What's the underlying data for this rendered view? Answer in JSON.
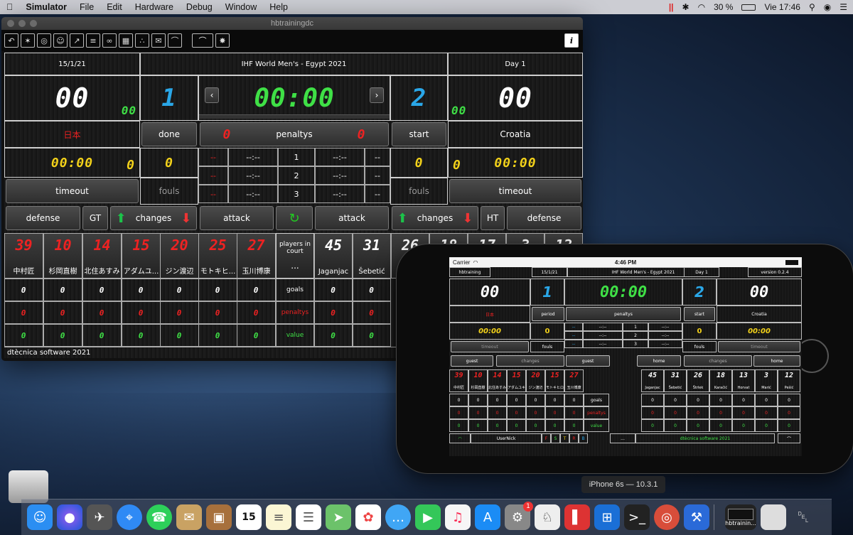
{
  "menubar": {
    "apple": "",
    "app": "Simulator",
    "items": [
      "File",
      "Edit",
      "Hardware",
      "Debug",
      "Window",
      "Help"
    ],
    "battery": "30 %",
    "clock": "Vie 17:46"
  },
  "window": {
    "title": "hbtrainingdc"
  },
  "board": {
    "date": "15/1/21",
    "event": "IHF World Men's - Egypt 2021",
    "day": "Day 1",
    "home_score": "00",
    "home_fouls_small": "00",
    "home_number": "1",
    "clock": "00:00",
    "away_number": "2",
    "away_score": "00",
    "away_fouls_small": "00",
    "home_name": "日本",
    "done_label": "done",
    "penalty_home": "0",
    "penaltys_label": "penaltys",
    "penalty_away": "0",
    "start_label": "start",
    "away_name": "Croatia",
    "home_timer": "00:00",
    "home_timer_count": "0",
    "home_fouls": "0",
    "away_fouls": "0",
    "away_timer_count": "0",
    "away_timer": "00:00",
    "timeout_label": "timeout",
    "fouls_label": "fouls",
    "periods": [
      {
        "ld": "--",
        "lt": "--:--",
        "n": "1",
        "rt": "--:--",
        "rd": "--"
      },
      {
        "ld": "--",
        "lt": "--:--",
        "n": "2",
        "rt": "--:--",
        "rd": "--"
      },
      {
        "ld": "--",
        "lt": "--:--",
        "n": "3",
        "rt": "--:--",
        "rd": "--"
      }
    ],
    "defense_label": "defense",
    "gt_label": "GT",
    "changes_label": "changes",
    "attack_label": "attack",
    "ht_label": "HT",
    "players_in_court": "players in court",
    "dots": "...",
    "home_players": [
      {
        "n": "39",
        "name": "中村匠"
      },
      {
        "n": "10",
        "name": "杉岡直樹"
      },
      {
        "n": "14",
        "name": "北住あすみ"
      },
      {
        "n": "15",
        "name": "アダムユ..."
      },
      {
        "n": "20",
        "name": "ジン渡辺"
      },
      {
        "n": "25",
        "name": "モトキヒ..."
      },
      {
        "n": "27",
        "name": "玉川博康"
      }
    ],
    "away_players": [
      {
        "n": "45",
        "name": "Jaganjac"
      },
      {
        "n": "31",
        "name": "Šebetić"
      },
      {
        "n": "26",
        "name": ""
      },
      {
        "n": "18",
        "name": ""
      },
      {
        "n": "17",
        "name": ""
      },
      {
        "n": "3",
        "name": ""
      },
      {
        "n": "12",
        "name": ""
      }
    ],
    "row_labels": {
      "goals": "goals",
      "penaltys": "penaltys",
      "value": "value"
    },
    "zero": "0",
    "footer": "dtècnica software 2021"
  },
  "phone": {
    "carrier": "Carrier",
    "time": "4:46 PM",
    "app": "hbtraining",
    "date": "15/1/21",
    "event": "IHF World Men's - Egypt 2021",
    "day": "Day 1",
    "version": "version 0.2.4",
    "home_score": "00",
    "home_small": "00",
    "home_number": "1",
    "clock": "00:00",
    "away_number": "2",
    "away_score": "00",
    "home_name": "日本",
    "period_label": "period",
    "pen_home": "0",
    "penaltys": "penaltys",
    "pen_away": "0",
    "start": "start",
    "away_name": "Croatia",
    "home_timer": "00:00",
    "home_count": "0",
    "away_count": "0",
    "away_timer": "00:00",
    "timeout": "timeout",
    "fouls": "fouls",
    "guest": "guest",
    "changes": "changes",
    "home": "home",
    "home_players": [
      {
        "n": "39",
        "name": "中村匠"
      },
      {
        "n": "10",
        "name": "杉岡直樹"
      },
      {
        "n": "14",
        "name": "北住あすみ"
      },
      {
        "n": "15",
        "name": "アダムユキ"
      },
      {
        "n": "20",
        "name": "ジン渡辺"
      },
      {
        "n": "15",
        "name": "モトキヒロ"
      },
      {
        "n": "27",
        "name": "玉川博康"
      }
    ],
    "away_players": [
      {
        "n": "45",
        "name": "Jaganjac"
      },
      {
        "n": "31",
        "name": "Šebetić"
      },
      {
        "n": "26",
        "name": "Štrlek"
      },
      {
        "n": "18",
        "name": "Karačić"
      },
      {
        "n": "13",
        "name": "Horvat"
      },
      {
        "n": "3",
        "name": "Marić"
      },
      {
        "n": "12",
        "name": "Pešić"
      }
    ],
    "goals": "goals",
    "value": "value",
    "user": "UserNick",
    "letters": [
      "F",
      "S",
      "T",
      "R",
      "B"
    ],
    "footer": "dtècnica software 2021"
  },
  "device_label": "iPhone 6s — 10.3.1",
  "dock_badge": "1",
  "dock_cal": "15",
  "dock_win": "hbtrainin..."
}
